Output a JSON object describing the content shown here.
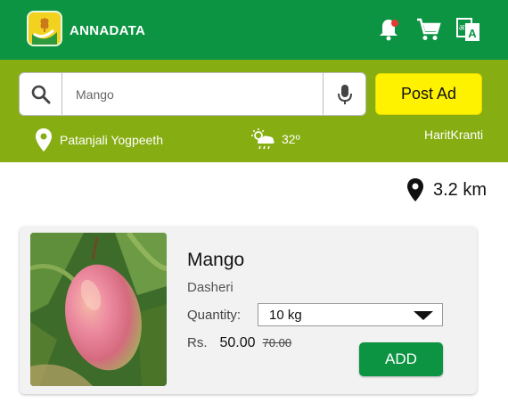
{
  "app": {
    "title": "ANNADATA"
  },
  "header": {
    "icons": [
      "notification-bell-icon",
      "cart-icon",
      "translate-icon"
    ],
    "notification_dot_color": "#e53935"
  },
  "search": {
    "value": "Mango",
    "placeholder": "Search"
  },
  "post_ad": {
    "label": "Post Ad"
  },
  "info_bar": {
    "location": "Patanjali Yogpeeth",
    "temperature": "32º",
    "weather_icon": "partly-cloudy-rain-icon",
    "brand": "HaritKranti"
  },
  "distance": {
    "value": "3.2 km"
  },
  "listing": {
    "name": "Mango",
    "variety": "Dasheri",
    "quantity_label": "Quantity:",
    "quantity_value": "10 kg",
    "currency": "Rs.",
    "price": "50.00",
    "old_price": "70.00",
    "add_label": "ADD"
  },
  "colors": {
    "primary": "#0c9443",
    "secondary": "#86ad12",
    "accent": "#fff200"
  }
}
